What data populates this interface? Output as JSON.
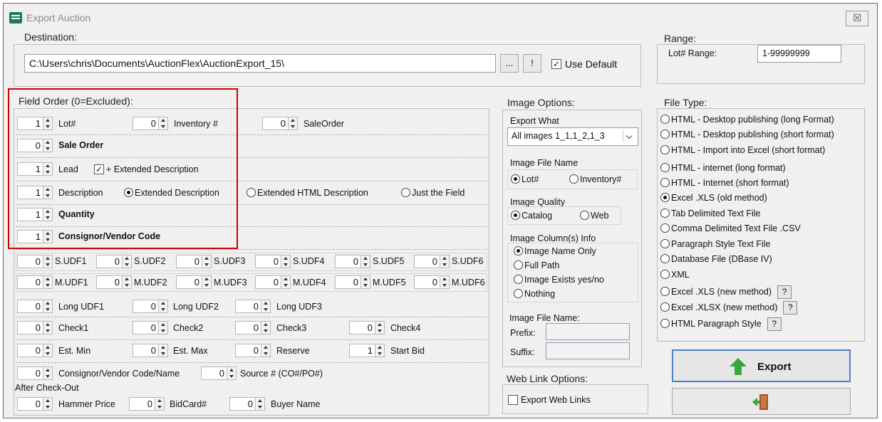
{
  "window": {
    "title": "Export Auction",
    "close": "☒"
  },
  "destination": {
    "label": "Destination:",
    "path": "C:\\Users\\chris\\Documents\\AuctionFlex\\AuctionExport_15\\",
    "browse": "...",
    "bang": "!",
    "use_default": "Use Default"
  },
  "range": {
    "label": "Range:",
    "lot_range_label": "Lot# Range:",
    "lot_range_value": "1-99999999"
  },
  "field_order": {
    "label": "Field Order (0=Excluded):",
    "lot": {
      "value": "1",
      "label": "Lot#"
    },
    "inventory": {
      "value": "0",
      "label": "Inventory #"
    },
    "saleorder": {
      "value": "0",
      "label": "SaleOrder"
    },
    "sale_order": {
      "value": "0",
      "label": "Sale Order"
    },
    "lead": {
      "value": "1",
      "label": "Lead",
      "ext": "+ Extended Description"
    },
    "description": {
      "value": "1",
      "label": "Description",
      "opt1": "Extended Description",
      "opt2": "Extended HTML Description",
      "opt3": "Just the Field"
    },
    "quantity": {
      "value": "1",
      "label": "Quantity"
    },
    "consignor_code": {
      "value": "1",
      "label": "Consignor/Vendor Code"
    },
    "sudf": [
      {
        "v": "0",
        "l": "S.UDF1"
      },
      {
        "v": "0",
        "l": "S.UDF2"
      },
      {
        "v": "0",
        "l": "S.UDF3"
      },
      {
        "v": "0",
        "l": "S.UDF4"
      },
      {
        "v": "0",
        "l": "S.UDF5"
      },
      {
        "v": "0",
        "l": "S.UDF6"
      }
    ],
    "mudf": [
      {
        "v": "0",
        "l": "M.UDF1"
      },
      {
        "v": "0",
        "l": "M.UDF2"
      },
      {
        "v": "0",
        "l": "M.UDF3"
      },
      {
        "v": "0",
        "l": "M.UDF4"
      },
      {
        "v": "0",
        "l": "M.UDF5"
      },
      {
        "v": "0",
        "l": "M.UDF6"
      }
    ],
    "long": [
      {
        "v": "0",
        "l": "Long UDF1"
      },
      {
        "v": "0",
        "l": "Long UDF2"
      },
      {
        "v": "0",
        "l": "Long UDF3"
      }
    ],
    "check": [
      {
        "v": "0",
        "l": "Check1"
      },
      {
        "v": "0",
        "l": "Check2"
      },
      {
        "v": "0",
        "l": "Check3"
      },
      {
        "v": "0",
        "l": "Check4"
      }
    ],
    "est": [
      {
        "v": "0",
        "l": "Est. Min"
      },
      {
        "v": "0",
        "l": "Est. Max"
      },
      {
        "v": "0",
        "l": "Reserve"
      },
      {
        "v": "1",
        "l": "Start Bid"
      }
    ],
    "consignor_name": {
      "value": "0",
      "label": "Consignor/Vendor Code/Name"
    },
    "source": {
      "value": "0",
      "label": "Source # (CO#/PO#)"
    },
    "after_checkout": "After Check-Out",
    "hammer": {
      "value": "0",
      "label": "Hammer Price"
    },
    "bidcard": {
      "value": "0",
      "label": "BidCard#"
    },
    "buyer": {
      "value": "0",
      "label": "Buyer Name"
    }
  },
  "image_options": {
    "label": "Image Options:",
    "export_what_label": "Export What",
    "export_what_value": "All images 1_1,1_2,1_3",
    "file_name_label": "Image File Name",
    "lot": "Lot#",
    "inventory": "Inventory#",
    "quality_label": "Image Quality",
    "catalog": "Catalog",
    "web": "Web",
    "columns_label": "Image Column(s) Info",
    "col_opts": [
      "Image Name Only",
      "Full Path",
      "Image Exists yes/no",
      "Nothing"
    ],
    "file_name2_label": "Image File Name:",
    "prefix": "Prefix:",
    "suffix": "Suffix:"
  },
  "web_link": {
    "label": "Web Link Options:",
    "export": "Export Web Links"
  },
  "file_type": {
    "label": "File Type:",
    "options": [
      "HTML - Desktop publishing  (long Format)",
      "HTML - Desktop publishing (short format)",
      "HTML - Import into Excel (short format)",
      "HTML - internet (long format)",
      "HTML - Internet (short format)",
      "Excel .XLS (old method)",
      "Tab Delimited Text File",
      "Comma Delimited Text File  .CSV",
      "Paragraph Style Text File",
      "Database File (DBase IV)",
      "XML",
      "Excel .XLS (new method)",
      "Excel .XLSX (new method)",
      "HTML Paragraph Style"
    ],
    "help": "?"
  },
  "actions": {
    "export": "Export"
  }
}
